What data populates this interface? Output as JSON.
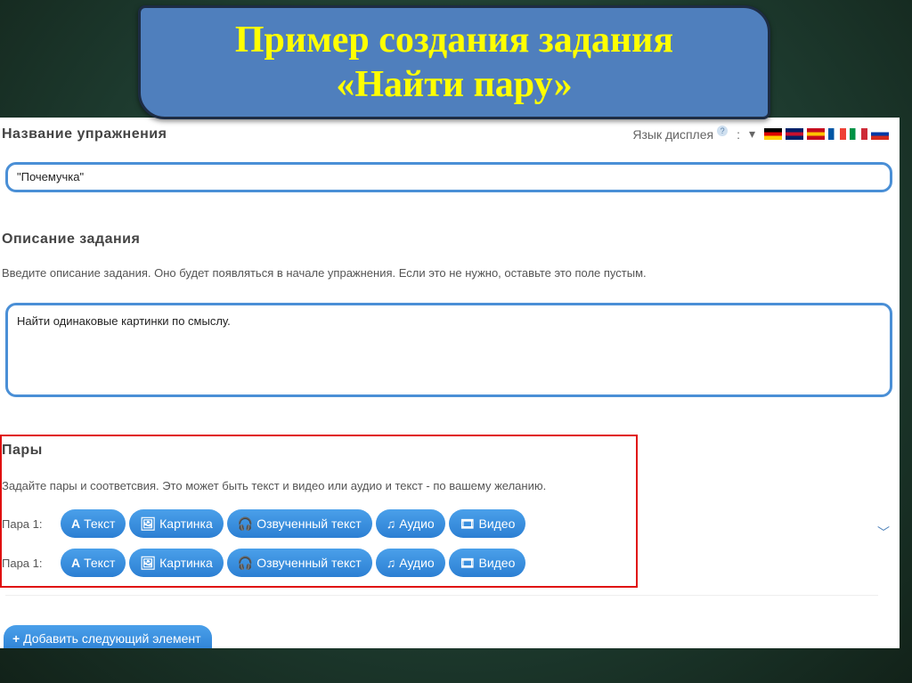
{
  "slide": {
    "title_line1": "Пример создания задания",
    "title_line2": "«Найти пару»"
  },
  "header": {
    "section_title": "Название упражнения",
    "language_label": "Язык дисплея",
    "help": "?",
    "colon": ":",
    "dropdown": "▾",
    "flags": [
      {
        "name": "de",
        "colors": [
          "#000000",
          "#dd0000",
          "#ffce00"
        ]
      },
      {
        "name": "gb",
        "colors": [
          "#012169",
          "#c8102e",
          "#012169"
        ]
      },
      {
        "name": "es",
        "colors": [
          "#c60b1e",
          "#ffc400",
          "#c60b1e"
        ]
      },
      {
        "name": "fr",
        "colors": [
          "#0055a4",
          "#ffffff",
          "#ef4135"
        ]
      },
      {
        "name": "it",
        "colors": [
          "#009246",
          "#ffffff",
          "#ce2b37"
        ]
      },
      {
        "name": "ru",
        "colors": [
          "#ffffff",
          "#0039a6",
          "#d52b1e"
        ]
      }
    ]
  },
  "title_input": {
    "value": "\"Почемучка\""
  },
  "description": {
    "heading": "Описание задания",
    "hint": "Введите описание задания. Оно будет появляться в начале упражнения. Если это не нужно, оставьте это поле пустым.",
    "value": "Найти одинаковые картинки по смыслу."
  },
  "pairs": {
    "heading": "Пары",
    "hint": "Задайте пары и соответсвия. Это может быть текст и видео или аудио и текст - по вашему желанию.",
    "rows": [
      {
        "label": "Пара 1:"
      },
      {
        "label": "Пара 1:"
      }
    ],
    "buttons": {
      "text": "Текст",
      "image": "Картинка",
      "voiced": "Озвученный текст",
      "audio": "Аудио",
      "video": "Видео"
    },
    "icons": {
      "text": "A",
      "image": "🖼",
      "voiced": "🎧",
      "audio": "♫",
      "video": "🎞"
    }
  },
  "add_button": {
    "icon": "+",
    "label": "Добавить следующий элемент"
  },
  "colors": {
    "accent": "#2c7fd3",
    "highlight_border": "#e01010",
    "title_text": "#ffff00",
    "banner": "#4f7fbd"
  }
}
